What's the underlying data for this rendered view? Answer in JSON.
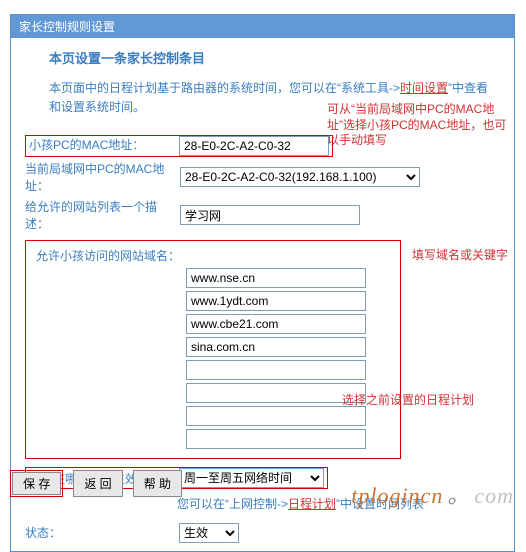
{
  "panel": {
    "title": "家长控制规则设置"
  },
  "subtitle": "本页设置一条家长控制条目",
  "intro": {
    "before": "本页面中的日程计划基于路由器的系统时间，您可以在“系统工具->",
    "link": "时间设置",
    "after": "”中查看和设置系统时间。"
  },
  "annotations": {
    "top1": "可从“当前局域网中PC的MAC地址”选择小孩PC的MAC地址，也可以手动填写",
    "right1": "填写域名或关键字",
    "right2": "选择之前设置的日程计划"
  },
  "mac": {
    "label": "小孩PC的MAC地址：",
    "value": "28-E0-2C-A2-C0-32"
  },
  "curmac": {
    "label": "当前局域网中PC的MAC地址：",
    "selected": "28-E0-2C-A2-C0-32(192.168.1.100)"
  },
  "desc": {
    "label": "给允许的网站列表一个描述：",
    "value": "学习网"
  },
  "sites": {
    "label": "允许小孩访问的网站域名：",
    "values": [
      "www.nse.cn",
      "www.1ydt.com",
      "www.cbe21.com",
      "sina.com.cn",
      "",
      "",
      "",
      ""
    ]
  },
  "schedule": {
    "label": "希望在哪些时候生效：",
    "selected": "周一至周五网络时间",
    "note_before": "您可以在“上网控制->",
    "note_link": "日程计划",
    "note_after": "”中设置时间列表"
  },
  "status": {
    "label": "状态：",
    "selected": "生效"
  },
  "buttons": {
    "save": "保 存",
    "back": "返 回",
    "help": "帮 助"
  },
  "watermark": {
    "t1": "tplogincn",
    "t2": "com"
  }
}
